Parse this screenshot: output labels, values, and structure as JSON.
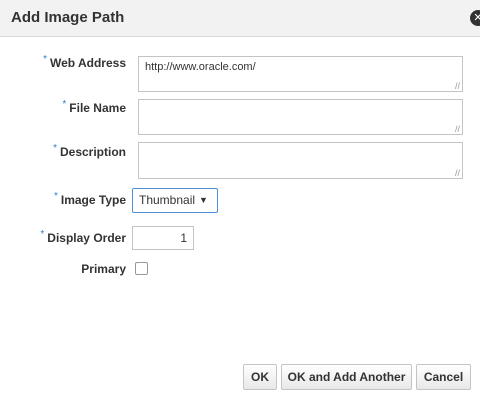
{
  "dialog": {
    "title": "Add Image Path",
    "close_icon": "close-icon",
    "required_marker": "*"
  },
  "fields": {
    "web_address": {
      "label": "Web Address",
      "value": "http://www.oracle.com/"
    },
    "file_name": {
      "label": "File Name",
      "value": ""
    },
    "description": {
      "label": "Description",
      "value": ""
    },
    "image_type": {
      "label": "Image Type",
      "value": "Thumbnail"
    },
    "display_order": {
      "label": "Display Order",
      "value": "1"
    },
    "primary": {
      "label": "Primary",
      "checked": false
    }
  },
  "buttons": {
    "ok": "OK",
    "ok_add_another": "OK and Add Another",
    "cancel": "Cancel"
  },
  "colors": {
    "required": "#2f7fc9",
    "select_border": "#4d90d6",
    "header_bg": "#f2f2f2"
  }
}
